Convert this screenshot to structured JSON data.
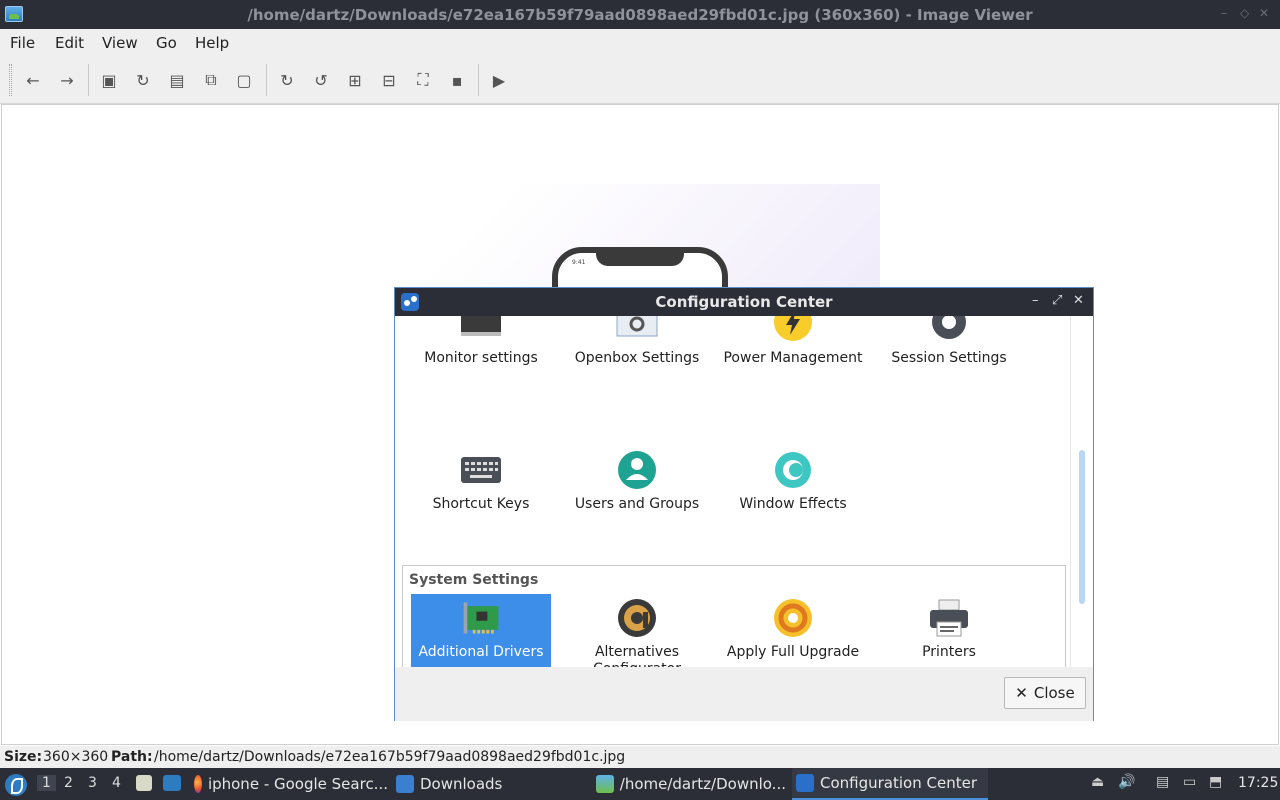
{
  "window": {
    "title": "/home/dartz/Downloads/e72ea167b59f79aad0898aed29fbd01c.jpg (360x360) - Image Viewer",
    "controls": [
      "–",
      "◇",
      "✕"
    ]
  },
  "menubar": {
    "items": [
      "File",
      "Edit",
      "View",
      "Go",
      "Help"
    ]
  },
  "toolbar": {
    "buttons": [
      {
        "name": "back-icon",
        "glyph": "←"
      },
      {
        "name": "forward-icon",
        "glyph": "→"
      },
      {
        "name": "open-icon",
        "glyph": "▣"
      },
      {
        "name": "reload-icon",
        "glyph": "↻"
      },
      {
        "name": "save-icon",
        "glyph": "▤"
      },
      {
        "name": "copy-icon",
        "glyph": "⧉"
      },
      {
        "name": "paste-icon",
        "glyph": "▢"
      },
      {
        "name": "rotate-cw-icon",
        "glyph": "↻"
      },
      {
        "name": "rotate-ccw-icon",
        "glyph": "↺"
      },
      {
        "name": "zoom-in-icon",
        "glyph": "⊞"
      },
      {
        "name": "zoom-out-icon",
        "glyph": "⊟"
      },
      {
        "name": "fit-icon",
        "glyph": "⛶"
      },
      {
        "name": "original-size-icon",
        "glyph": "▪"
      },
      {
        "name": "slideshow-icon",
        "glyph": "▶"
      }
    ]
  },
  "preview": {
    "phone_time": "9:41"
  },
  "statusbar": {
    "size_label": "Size:",
    "size_value": "360×360",
    "path_label": "Path:",
    "path_value": "/home/dartz/Downloads/e72ea167b59f79aad0898aed29fbd01c.jpg"
  },
  "dialog": {
    "title": "Configuration Center",
    "controls": [
      "–",
      "⤢",
      "✕"
    ],
    "items_row1": [
      {
        "label": "Monitor settings",
        "icon": "monitor-icon"
      },
      {
        "label": "Openbox Settings",
        "icon": "openbox-settings-icon"
      },
      {
        "label": "Power Management",
        "icon": "power-management-icon"
      },
      {
        "label": "Session Settings",
        "icon": "session-settings-icon"
      }
    ],
    "items_row2": [
      {
        "label": "Shortcut Keys",
        "icon": "keyboard-icon"
      },
      {
        "label": "Users and Groups",
        "icon": "users-icon"
      },
      {
        "label": "Window Effects",
        "icon": "window-effects-icon"
      }
    ],
    "system_section": {
      "title": "System Settings",
      "items": [
        {
          "label": "Additional Drivers",
          "icon": "drivers-card-icon",
          "selected": true
        },
        {
          "label": "Alternatives Configurator",
          "icon": "alternatives-icon",
          "selected": false
        },
        {
          "label": "Apply Full Upgrade",
          "icon": "upgrade-icon",
          "selected": false
        },
        {
          "label": "Printers",
          "icon": "printer-icon",
          "selected": false
        }
      ]
    },
    "close_label": "Close",
    "close_glyph": "✕"
  },
  "taskbar": {
    "workspaces": [
      "1",
      "2",
      "3",
      "4"
    ],
    "tasks": [
      {
        "label": "iphone - Google Searc...",
        "icon": "firefox-icon"
      },
      {
        "label": "Downloads",
        "icon": "folder-icon"
      },
      {
        "label": "/home/dartz/Downlo...",
        "icon": "image-viewer-icon"
      },
      {
        "label": "Configuration Center",
        "icon": "config-center-icon",
        "active": true
      }
    ],
    "clock": "17:25"
  },
  "colors": {
    "titlebar": "#2b2e37",
    "selection": "#3d8ee8",
    "accent_border": "#5c8fc7"
  }
}
